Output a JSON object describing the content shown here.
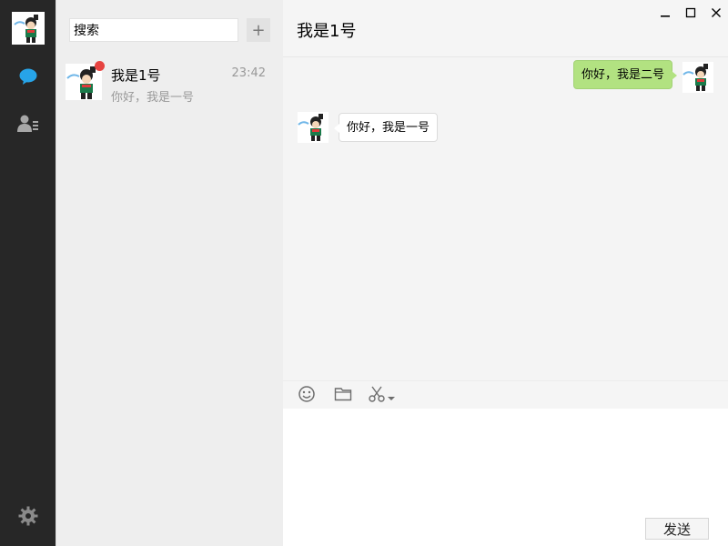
{
  "window": {
    "minimize_icon": "minimize-icon",
    "maximize_icon": "maximize-icon",
    "close_icon": "close-icon"
  },
  "sidebar": {
    "avatar_icon": "user-avatar",
    "chat_icon": "chat-bubble-icon",
    "contacts_icon": "contacts-icon",
    "settings_icon": "gear-icon",
    "accent_color": "#27a4e8"
  },
  "session_list": {
    "search": {
      "value": "搜索",
      "placeholder": "搜索"
    },
    "add_label": "+",
    "sessions": [
      {
        "name": "我是1号",
        "time": "23:42",
        "preview": "你好，我是一号",
        "unread_badge": true
      }
    ]
  },
  "chat": {
    "title": "我是1号",
    "messages": [
      {
        "from": "me",
        "text": "你好，我是二号"
      },
      {
        "from": "other",
        "text": "你好，我是一号"
      }
    ],
    "toolbar": {
      "emoji_icon": "smiley-icon",
      "file_icon": "folder-icon",
      "screenshot_icon": "scissors-icon"
    },
    "send_label": "发送"
  },
  "colors": {
    "rail_bg": "#272727",
    "my_bubble": "#b2e281",
    "badge": "#e64340"
  }
}
